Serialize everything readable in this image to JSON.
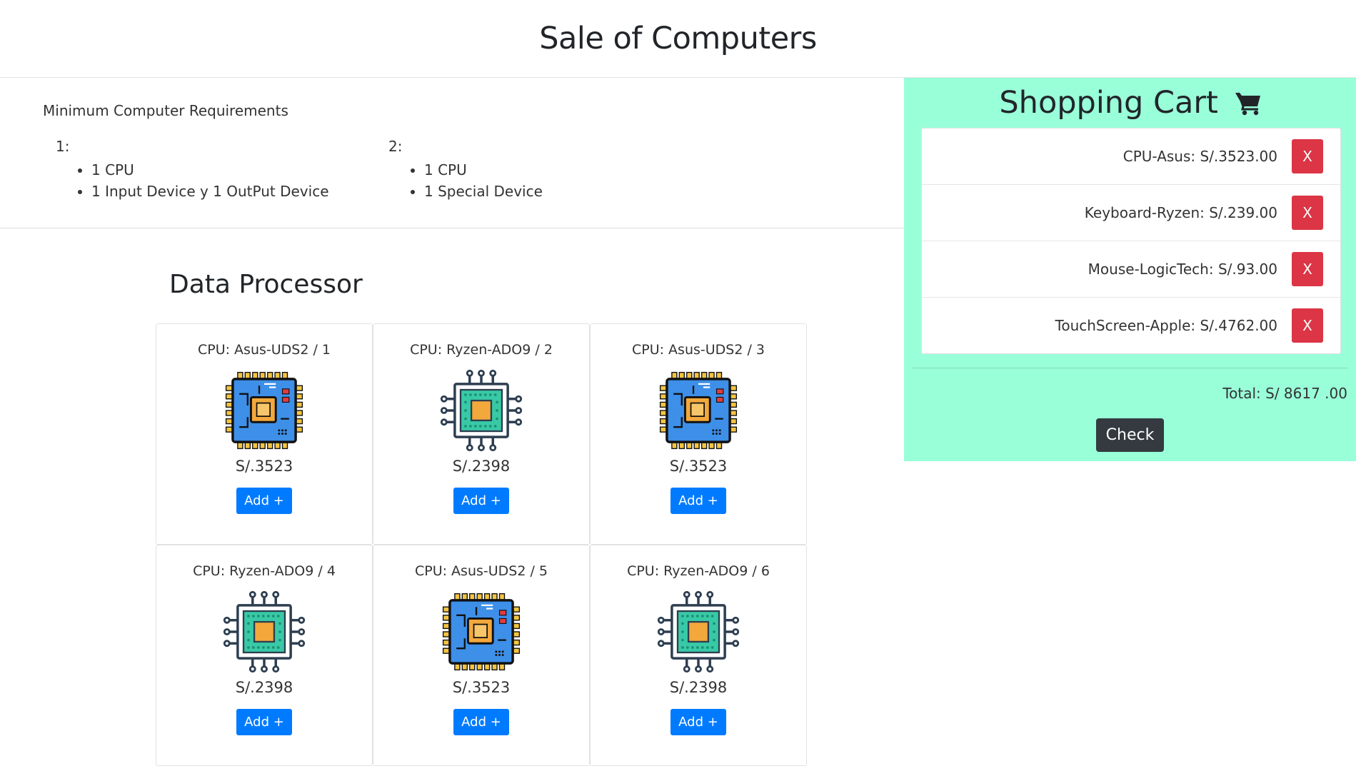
{
  "header": {
    "title": "Sale of Computers"
  },
  "requirements": {
    "heading": "Minimum Computer Requirements",
    "options": [
      {
        "number": "1:",
        "items": [
          "1 CPU",
          "1 Input Device y 1 OutPut Device"
        ]
      },
      {
        "number": "2:",
        "items": [
          "1 CPU",
          "1 Special Device"
        ]
      }
    ]
  },
  "section": {
    "title": "Data Processor"
  },
  "products": [
    {
      "name": "CPU: Asus-UDS2 / 1",
      "price": "S/.3523",
      "icon": "motherboard-chip-icon",
      "add_label": "Add +"
    },
    {
      "name": "CPU: Ryzen-ADO9 / 2",
      "price": "S/.2398",
      "icon": "processor-chip-icon",
      "add_label": "Add +"
    },
    {
      "name": "CPU: Asus-UDS2 / 3",
      "price": "S/.3523",
      "icon": "motherboard-chip-icon",
      "add_label": "Add +"
    },
    {
      "name": "CPU: Ryzen-ADO9 / 4",
      "price": "S/.2398",
      "icon": "processor-chip-icon",
      "add_label": "Add +"
    },
    {
      "name": "CPU: Asus-UDS2 / 5",
      "price": "S/.3523",
      "icon": "motherboard-chip-icon",
      "add_label": "Add +"
    },
    {
      "name": "CPU: Ryzen-ADO9 / 6",
      "price": "S/.2398",
      "icon": "processor-chip-icon",
      "add_label": "Add +"
    }
  ],
  "cart": {
    "title": "Shopping Cart",
    "icon": "shopping-cart-icon",
    "items": [
      {
        "label": "CPU-Asus: S/.3523.00",
        "remove_label": "X"
      },
      {
        "label": "Keyboard-Ryzen: S/.239.00",
        "remove_label": "X"
      },
      {
        "label": "Mouse-LogicTech: S/.93.00",
        "remove_label": "X"
      },
      {
        "label": "TouchScreen-Apple: S/.4762.00",
        "remove_label": "X"
      }
    ],
    "total": "Total: S/ 8617 .00",
    "check_label": "Check"
  },
  "colors": {
    "cart_background": "#99ffd9",
    "primary": "#007bff",
    "danger": "#dc3545",
    "dark": "#343a40"
  }
}
